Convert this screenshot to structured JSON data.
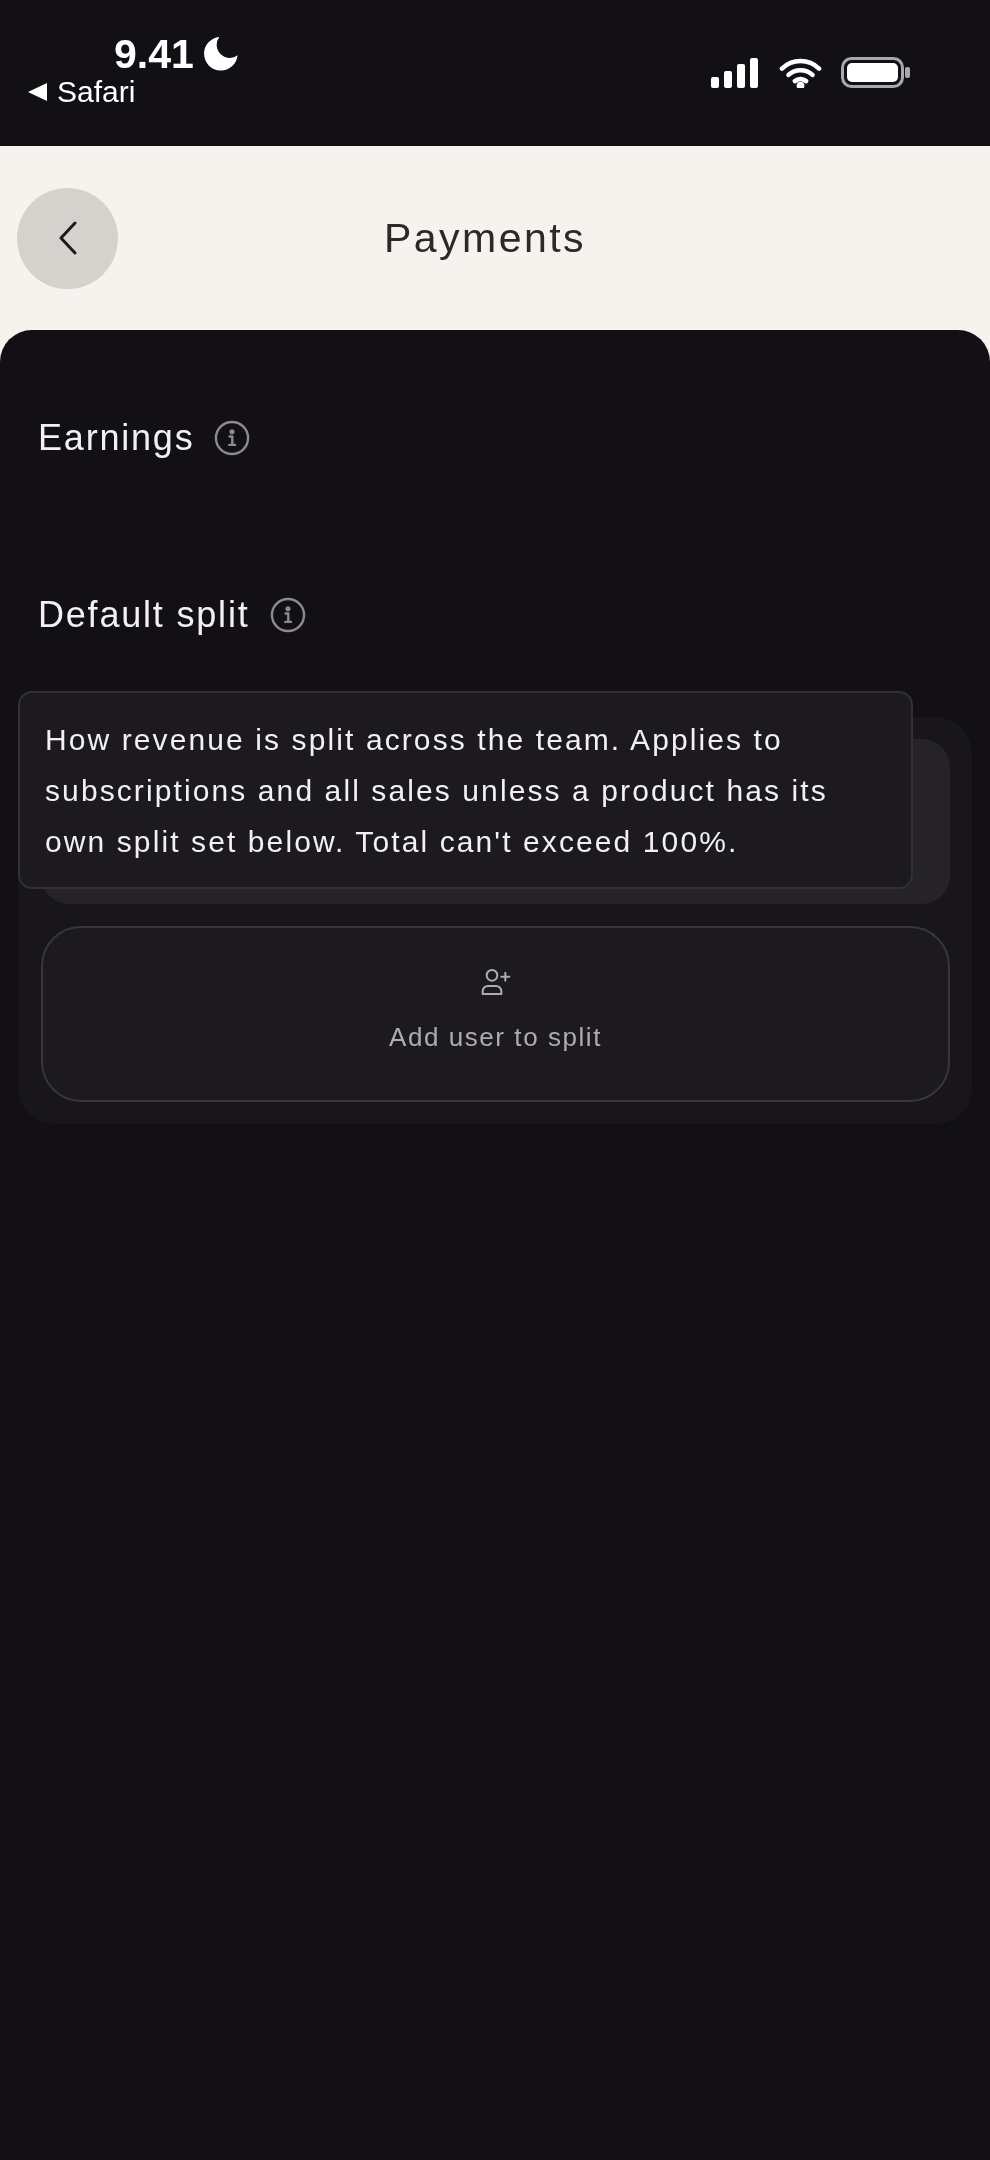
{
  "status_bar": {
    "time": "9.41",
    "back_label": "Safari"
  },
  "header": {
    "title": "Payments"
  },
  "sections": [
    {
      "title": "Earnings"
    },
    {
      "title": "Default split",
      "tooltip": "How revenue is split across the team. Applies to subscriptions and all sales unless a product has its own split set below. Total can't exceed 100%.",
      "add_button": "Add user to split"
    }
  ]
}
